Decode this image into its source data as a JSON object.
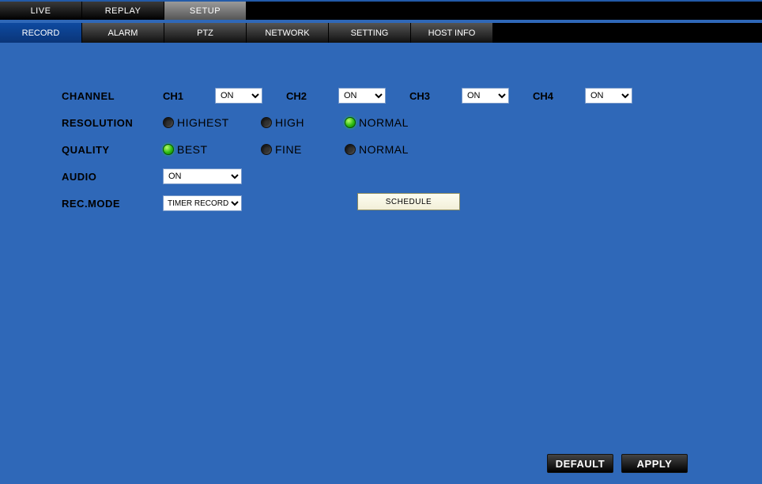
{
  "topTabs": {
    "live": "LIVE",
    "replay": "REPLAY",
    "setup": "SETUP"
  },
  "subTabs": {
    "record": "RECORD",
    "alarm": "ALARM",
    "ptz": "PTZ",
    "network": "NETWORK",
    "setting": "SETTING",
    "hostInfo": "HOST INFO"
  },
  "labels": {
    "channel": "CHANNEL",
    "resolution": "RESOLUTION",
    "quality": "QUALITY",
    "audio": "AUDIO",
    "recMode": "REC.MODE"
  },
  "channels": {
    "ch1": {
      "label": "CH1",
      "value": "ON"
    },
    "ch2": {
      "label": "CH2",
      "value": "ON"
    },
    "ch3": {
      "label": "CH3",
      "value": "ON"
    },
    "ch4": {
      "label": "CH4",
      "value": "ON"
    }
  },
  "resolution": {
    "highest": "HIGHEST",
    "high": "HIGH",
    "normal": "NORMAL",
    "selected": "NORMAL"
  },
  "quality": {
    "best": "BEST",
    "fine": "FINE",
    "normal": "NORMAL",
    "selected": "BEST"
  },
  "audio": {
    "value": "ON"
  },
  "recMode": {
    "value": "TIMER RECORD"
  },
  "buttons": {
    "schedule": "SCHEDULE",
    "default": "DEFAULT",
    "apply": "APPLY"
  }
}
